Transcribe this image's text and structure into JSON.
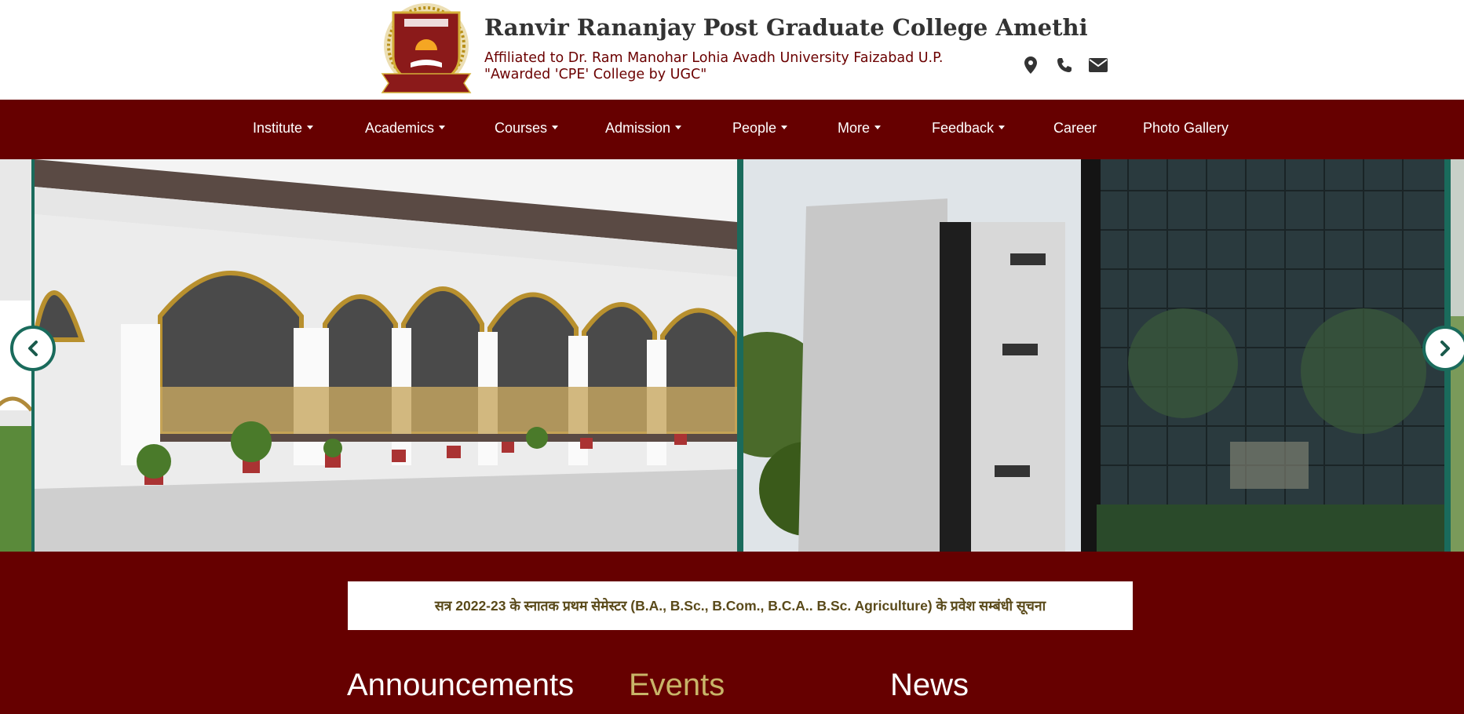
{
  "header": {
    "title": "Ranvir Rananjay Post Graduate College Amethi",
    "affiliation": "Affiliated to Dr. Ram Manohar Lohia Avadh University Faizabad U.P.",
    "award": "\"Awarded 'CPE' College by UGC\"",
    "icons": [
      "map-marker-icon",
      "phone-icon",
      "envelope-icon"
    ]
  },
  "nav": {
    "items": [
      {
        "label": "Institute",
        "dropdown": true
      },
      {
        "label": "Academics",
        "dropdown": true
      },
      {
        "label": "Courses",
        "dropdown": true
      },
      {
        "label": "Admission",
        "dropdown": true
      },
      {
        "label": "People",
        "dropdown": true
      },
      {
        "label": "More",
        "dropdown": true
      },
      {
        "label": "Feedback",
        "dropdown": true
      },
      {
        "label": "Career",
        "dropdown": false
      },
      {
        "label": "Photo Gallery",
        "dropdown": false
      }
    ]
  },
  "slider": {
    "prev_icon": "chevron-left-icon",
    "next_icon": "chevron-right-icon"
  },
  "notice": {
    "text": "सत्र 2022-23 के स्नातक प्रथम सेमेस्टर (B.A., B.Sc., B.Com., B.C.A.. B.Sc. Agriculture) के प्रवेश सम्बंधी सूचना"
  },
  "tabs": {
    "announcements": "Announcements",
    "events": "Events",
    "news": "News"
  },
  "colors": {
    "maroon": "#660000",
    "teal": "#1a6b5c",
    "events_gold": "#c8b468"
  }
}
